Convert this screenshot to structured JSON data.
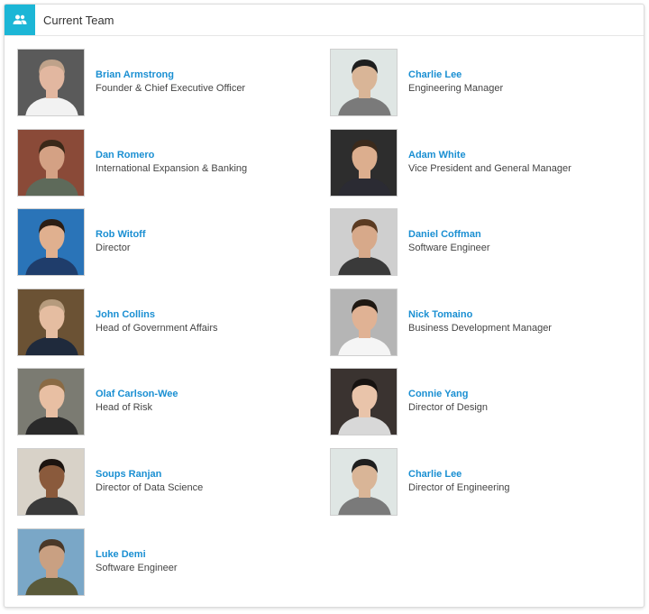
{
  "header": {
    "title": "Current Team",
    "icon": "people-icon",
    "accent": "#1cb6d6"
  },
  "members": [
    {
      "name": "Brian Armstrong",
      "role": "Founder & Chief Executive Officer",
      "bg": "#5a5a5a",
      "skin": "#e2b7a0",
      "hair": "#bfa28a",
      "shirt": "#f2f2f2"
    },
    {
      "name": "Charlie Lee",
      "role": "Engineering Manager",
      "bg": "#dfe6e4",
      "skin": "#d9b597",
      "hair": "#1e1e1e",
      "shirt": "#7a7a7a"
    },
    {
      "name": "Dan Romero",
      "role": "International Expansion & Banking",
      "bg": "#8a4a38",
      "skin": "#d4a184",
      "hair": "#3a2818",
      "shirt": "#5e6a5a"
    },
    {
      "name": "Adam White",
      "role": "Vice President and General Manager",
      "bg": "#2d2d2d",
      "skin": "#dcae8e",
      "hair": "#3b2a1c",
      "shirt": "#2b2b33"
    },
    {
      "name": "Rob Witoff",
      "role": "Director",
      "bg": "#2a74b8",
      "skin": "#e0b08f",
      "hair": "#2c1e14",
      "shirt": "#1f3d6b"
    },
    {
      "name": "Daniel Coffman",
      "role": "Software Engineer",
      "bg": "#cfcfcf",
      "skin": "#d7a98a",
      "hair": "#5b3b22",
      "shirt": "#3a3a3a"
    },
    {
      "name": "John Collins",
      "role": "Head of Government Affairs",
      "bg": "#6b5234",
      "skin": "#e5bda1",
      "hair": "#b69b7d",
      "shirt": "#1f2a3c"
    },
    {
      "name": "Nick Tomaino",
      "role": "Business Development Manager",
      "bg": "#b5b5b5",
      "skin": "#e0b294",
      "hair": "#1f1812",
      "shirt": "#f5f5f5"
    },
    {
      "name": "Olaf Carlson-Wee",
      "role": "Head of Risk",
      "bg": "#7b7b72",
      "skin": "#e8bfa3",
      "hair": "#8a6a44",
      "shirt": "#2a2a2a"
    },
    {
      "name": "Connie Yang",
      "role": "Director of Design",
      "bg": "#3a3330",
      "skin": "#e9c4aa",
      "hair": "#161210",
      "shirt": "#d8d8d8"
    },
    {
      "name": "Soups Ranjan",
      "role": "Director of Data Science",
      "bg": "#d8d2c8",
      "skin": "#8a5a3c",
      "hair": "#1c1410",
      "shirt": "#3a3a3a"
    },
    {
      "name": "Charlie Lee",
      "role": "Director of Engineering",
      "bg": "#dfe6e4",
      "skin": "#d9b597",
      "hair": "#1e1e1e",
      "shirt": "#7a7a7a"
    },
    {
      "name": "Luke Demi",
      "role": "Software Engineer",
      "bg": "#7aa7c7",
      "skin": "#c9a082",
      "hair": "#4a3828",
      "shirt": "#5a5a3a"
    }
  ]
}
